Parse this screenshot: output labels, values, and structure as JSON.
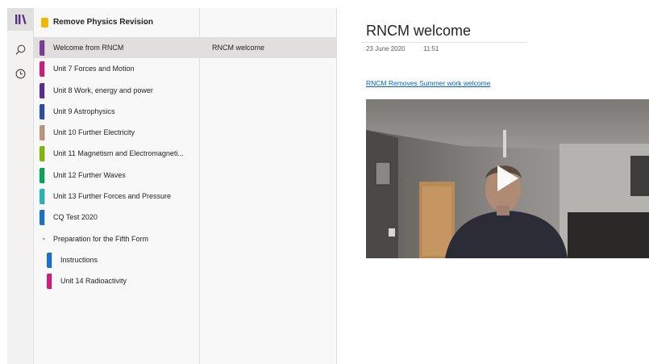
{
  "rail": {
    "icons": [
      "notebooks-icon",
      "search-icon",
      "recent-icon"
    ]
  },
  "notebook": {
    "title": "Remove Physics Revision",
    "color": "#f2b705"
  },
  "sections": [
    {
      "label": "Welcome from RNCM",
      "color": "#7d3c98",
      "selected": true
    },
    {
      "label": "Unit 7 Forces and Motion",
      "color": "#c8207c"
    },
    {
      "label": "Unit 8 Work, energy and power",
      "color": "#5c2d91"
    },
    {
      "label": "Unit 9 Astrophysics",
      "color": "#2e4ea3"
    },
    {
      "label": "Unit 10 Further Electricity",
      "color": "#b8977e"
    },
    {
      "label": "Unit 11 Magnetism and Electromagneti...",
      "color": "#7fba00"
    },
    {
      "label": "Unit 12 Further Waves",
      "color": "#00a85a"
    },
    {
      "label": "Unit 13 Further Forces and Pressure",
      "color": "#22b8b0"
    },
    {
      "label": "CQ Test 2020",
      "color": "#1a73c8"
    }
  ],
  "section_group": {
    "label": "Preparation for the Fifth Form",
    "children": [
      {
        "label": "Instructions",
        "color": "#1a73c8"
      },
      {
        "label": "Unit 14 Radioactivity",
        "color": "#c8207c"
      }
    ]
  },
  "pages": [
    {
      "label": "RNCM welcome",
      "selected": true
    }
  ],
  "page": {
    "title": "RNCM welcome",
    "date": "23 June 2020",
    "time": "11:51",
    "link": "RNCM Removes Summer work welcome"
  }
}
